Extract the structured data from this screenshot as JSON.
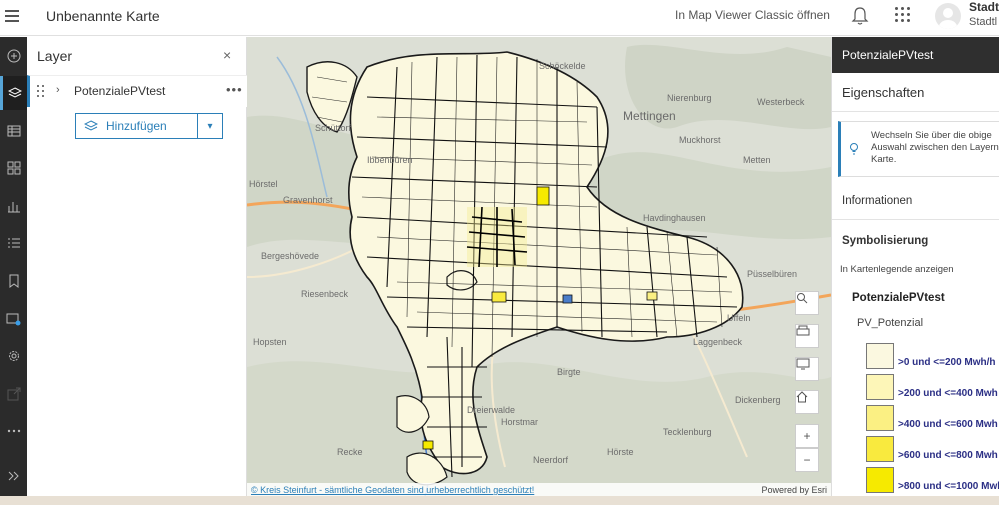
{
  "header": {
    "title": "Unbenannte Karte",
    "open_classic": "In Map Viewer Classic öffnen",
    "user_name": "Stadt",
    "user_org": "Stadtl"
  },
  "rail": {
    "items": [
      "add-icon",
      "layers-icon",
      "table-icon",
      "charts-icon",
      "bar-chart-icon",
      "legend-icon",
      "bookmark-icon",
      "basemap-icon",
      "settings-icon",
      "share-icon",
      "more-icon",
      "expand-icon"
    ]
  },
  "layer_panel": {
    "title": "Layer",
    "close": "×",
    "layer_name": "PotenzialePVtest",
    "more": "•••",
    "add_label": "Hinzufügen"
  },
  "map": {
    "labels": [
      "Schüttorf",
      "Schöckelde",
      "Mettingen",
      "Nierenburg",
      "Westerbeck",
      "Muckhorst",
      "Metten",
      "Gravenhorst",
      "Hörstel",
      "Bergeshövede",
      "Havdinghausen",
      "Riesenbeck",
      "Dreierwalde",
      "Uffeln",
      "Püsselbüren",
      "Laggenbeck",
      "Dickenberg",
      "Hopsten",
      "Birgte",
      "Horstmar",
      "Recke",
      "Hörste",
      "Neerdorf",
      "Ibbenbüren",
      "Tecklenburg"
    ],
    "attribution_link": "© Kreis Steinfurt - sämtliche Geodaten sind urheberrechtlich geschützt!",
    "powered_by": "Powered by Esri",
    "zoom_in": "+",
    "zoom_out": "−"
  },
  "right_panel": {
    "header": "PotenzialePVtest",
    "properties_title": "Eigenschaften",
    "info_text": "Wechseln Sie über die obige Auswahl zwischen den Layern der Karte.",
    "section_info": "Informationen",
    "section_symbology": "Symbolisierung",
    "legend_toggle": "In Kartenlegende anzeigen",
    "legend_layer": "PotenzialePVtest",
    "legend_field": "PV_Potenzial",
    "legend": [
      {
        "label": ">0 und <=200 Mwh/h",
        "color": "#fbf8e0"
      },
      {
        "label": ">200 und <=400 Mwh",
        "color": "#fdf6b8"
      },
      {
        "label": ">400 und <=600 Mwh",
        "color": "#fbf083"
      },
      {
        "label": ">600 und <=800 Mwh",
        "color": "#f9ea3e"
      },
      {
        "label": ">800 und <=1000 Mwh",
        "color": "#f6ea00"
      }
    ]
  },
  "colors": {
    "accent": "#2b7fb8",
    "rail_bg": "#2b2b2b",
    "polygon_fill": "#fbf8df",
    "polygon_stroke": "#1a1a1a"
  }
}
